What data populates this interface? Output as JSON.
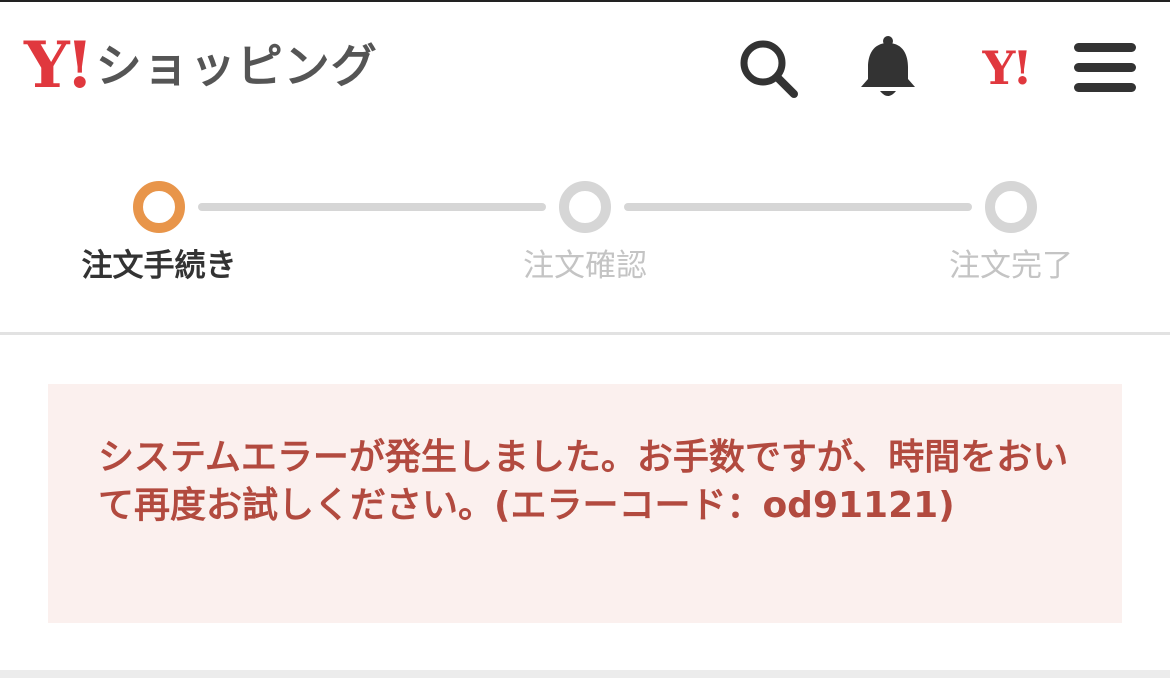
{
  "header": {
    "logo_mark": "Y!",
    "logo_text": "ショッピング",
    "account_mark": "Y!",
    "icons": [
      "search-icon",
      "bell-icon",
      "yahoo-japan-icon",
      "hamburger-menu-icon"
    ]
  },
  "stepper": {
    "steps": [
      {
        "label": "注文手続き",
        "state": "active"
      },
      {
        "label": "注文確認",
        "state": "inactive"
      },
      {
        "label": "注文完了",
        "state": "inactive"
      }
    ]
  },
  "error": {
    "message": "システムエラーが発生しました。お手数ですが、時間をおいて再度お試しください。(エラーコード：od91121)"
  },
  "colors": {
    "brand_red": "#e0383e",
    "step_active": "#e8954a",
    "step_inactive": "#d6d6d6",
    "error_bg": "#fbf0ee",
    "error_text": "#b24a3f"
  }
}
